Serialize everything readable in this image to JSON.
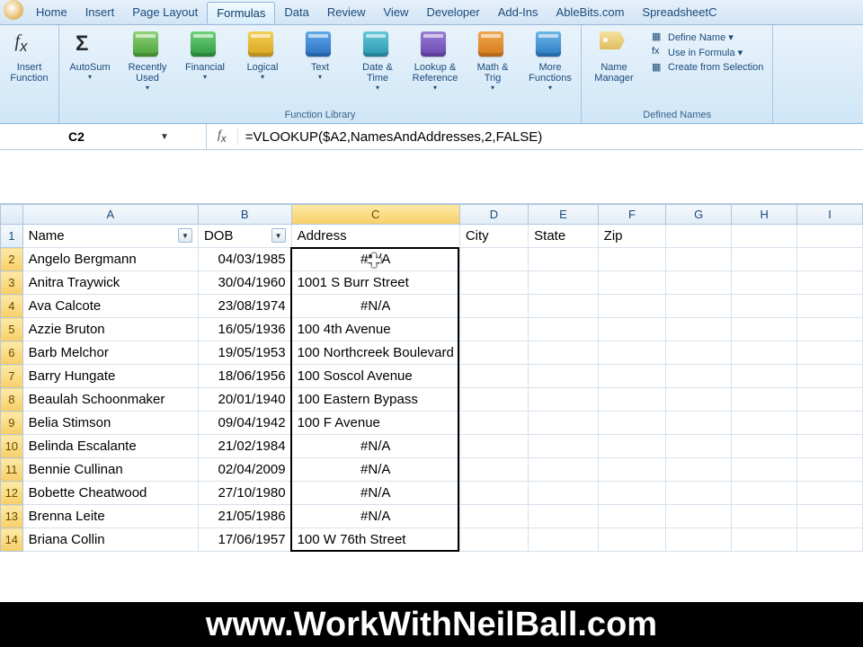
{
  "menu": {
    "items": [
      "Home",
      "Insert",
      "Page Layout",
      "Formulas",
      "Data",
      "Review",
      "View",
      "Developer",
      "Add-Ins",
      "AbleBits.com",
      "SpreadsheetC"
    ],
    "active_index": 3
  },
  "ribbon": {
    "insert_function": "Insert\nFunction",
    "library_label": "Function Library",
    "library": [
      {
        "label": "AutoSum",
        "icon": "sigma",
        "color": ""
      },
      {
        "label": "Recently\nUsed",
        "icon": "book",
        "color": "linear-gradient(#8fd17a,#4aa23a)"
      },
      {
        "label": "Financial",
        "icon": "book",
        "color": "linear-gradient(#6fd07a,#2e9a44)"
      },
      {
        "label": "Logical",
        "icon": "book",
        "color": "linear-gradient(#f2cf55,#d9a420)"
      },
      {
        "label": "Text",
        "icon": "book",
        "color": "linear-gradient(#5fa8e8,#2a6fc2)"
      },
      {
        "label": "Date &\nTime",
        "icon": "book",
        "color": "linear-gradient(#64c6d6,#2a97af)"
      },
      {
        "label": "Lookup &\nReference",
        "icon": "book",
        "color": "linear-gradient(#9a7dd6,#6a45b0)"
      },
      {
        "label": "Math\n& Trig",
        "icon": "book",
        "color": "linear-gradient(#f0a850,#d57818)"
      },
      {
        "label": "More\nFunctions",
        "icon": "book",
        "color": "linear-gradient(#6ab5e8,#2a7bc2)"
      }
    ],
    "name_manager": "Name\nManager",
    "defined_names_label": "Defined Names",
    "defined_items": [
      "Define Name",
      "Use in Formula",
      "Create from Selection"
    ]
  },
  "editbar": {
    "namebox": "C2",
    "formula": "=VLOOKUP($A2,NamesAndAddresses,2,FALSE)"
  },
  "columns": [
    "A",
    "B",
    "C",
    "D",
    "E",
    "F",
    "G",
    "H",
    "I"
  ],
  "active_col_index": 2,
  "headers": {
    "A": "Name",
    "B": "DOB",
    "C": "Address",
    "D": "City",
    "E": "State",
    "F": "Zip"
  },
  "rows": [
    {
      "n": 1,
      "A": "Name",
      "B": "DOB",
      "C": "Address",
      "D": "City",
      "E": "State",
      "F": "Zip"
    },
    {
      "n": 2,
      "A": "Angelo Bergmann",
      "B": "04/03/1985",
      "C": "#N/A"
    },
    {
      "n": 3,
      "A": "Anitra Traywick",
      "B": "30/04/1960",
      "C": "1001 S Burr Street"
    },
    {
      "n": 4,
      "A": "Ava Calcote",
      "B": "23/08/1974",
      "C": "#N/A"
    },
    {
      "n": 5,
      "A": "Azzie Bruton",
      "B": "16/05/1936",
      "C": "100 4th Avenue"
    },
    {
      "n": 6,
      "A": "Barb Melchor",
      "B": "19/05/1953",
      "C": "100 Northcreek Boulevard"
    },
    {
      "n": 7,
      "A": "Barry Hungate",
      "B": "18/06/1956",
      "C": "100 Soscol Avenue"
    },
    {
      "n": 8,
      "A": "Beaulah Schoonmaker",
      "B": "20/01/1940",
      "C": "100 Eastern Bypass"
    },
    {
      "n": 9,
      "A": "Belia Stimson",
      "B": "09/04/1942",
      "C": "100 F Avenue"
    },
    {
      "n": 10,
      "A": "Belinda Escalante",
      "B": "21/02/1984",
      "C": "#N/A"
    },
    {
      "n": 11,
      "A": "Bennie Cullinan",
      "B": "02/04/2009",
      "C": "#N/A"
    },
    {
      "n": 12,
      "A": "Bobette Cheatwood",
      "B": "27/10/1980",
      "C": "#N/A"
    },
    {
      "n": 13,
      "A": "Brenna Leite",
      "B": "21/05/1986",
      "C": "#N/A"
    },
    {
      "n": 14,
      "A": "Briana Collin",
      "B": "17/06/1957",
      "C": "100 W 76th Street"
    }
  ],
  "selection": {
    "col": "C",
    "row_start": 2,
    "row_end": 14
  },
  "footer": "www.WorkWithNeilBall.com"
}
